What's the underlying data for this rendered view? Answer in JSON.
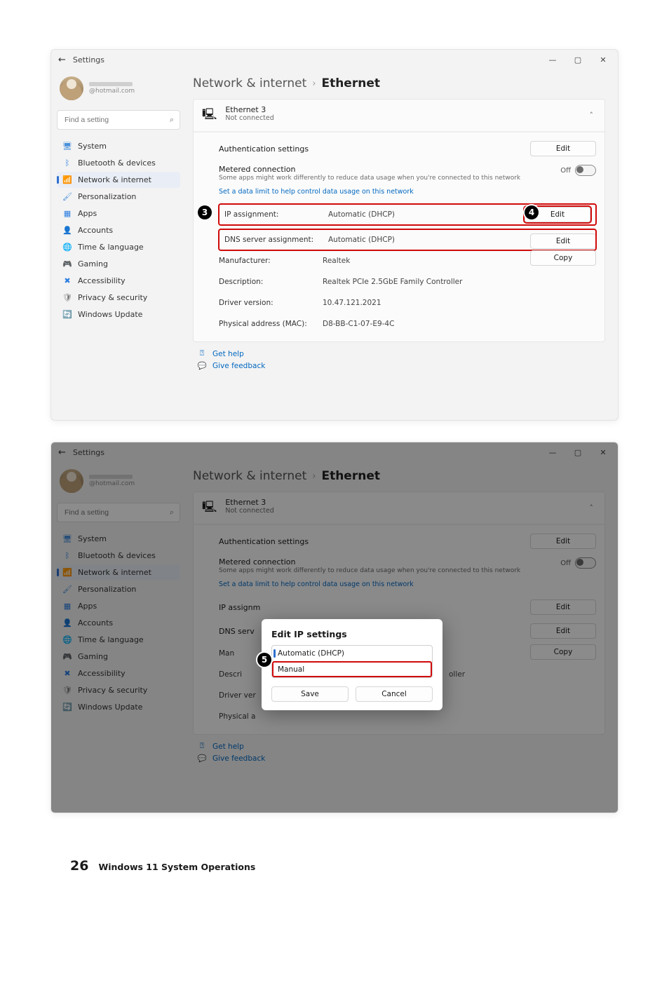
{
  "footer": {
    "page_number": "26",
    "book_title": "Windows 11 System Operations"
  },
  "window": {
    "app_title": "Settings",
    "account_email": "@hotmail.com",
    "search_placeholder": "Find a setting"
  },
  "sidebar_items": [
    {
      "icon": "🖥",
      "label": "System"
    },
    {
      "icon": "ᛒ",
      "label": "Bluetooth & devices"
    },
    {
      "icon": "📶",
      "label": "Network & internet"
    },
    {
      "icon": "🖌",
      "label": "Personalization"
    },
    {
      "icon": "▦",
      "label": "Apps"
    },
    {
      "icon": "👤",
      "label": "Accounts"
    },
    {
      "icon": "🌐",
      "label": "Time & language"
    },
    {
      "icon": "🎮",
      "label": "Gaming"
    },
    {
      "icon": "✖",
      "label": "Accessibility"
    },
    {
      "icon": "🛡",
      "label": "Privacy & security"
    },
    {
      "icon": "🔄",
      "label": "Windows Update"
    }
  ],
  "breadcrumb": {
    "a": "Network & internet",
    "b": "Ethernet"
  },
  "ethernet_header": {
    "name": "Ethernet 3",
    "status": "Not connected"
  },
  "rows": {
    "auth_label": "Authentication settings",
    "edit_btn": "Edit",
    "metered_label": "Metered connection",
    "metered_desc": "Some apps might work differently to reduce data usage when you're connected to this network",
    "metered_toggle": "Off",
    "data_limit_link": "Set a data limit to help control data usage on this network",
    "ip_label": "IP assignment:",
    "ip_value": "Automatic (DHCP)",
    "dns_label": "DNS server assignment:",
    "dns_value": "Automatic (DHCP)",
    "copy_btn": "Copy",
    "details": {
      "manufacturer_k": "Manufacturer:",
      "manufacturer_v": "Realtek",
      "description_k": "Description:",
      "description_v": "Realtek PCIe 2.5GbE Family Controller",
      "driver_k": "Driver version:",
      "driver_v": "10.47.121.2021",
      "mac_k": "Physical address (MAC):",
      "mac_v": "D8-BB-C1-07-E9-4C"
    }
  },
  "help": {
    "get_help": "Get help",
    "give_feedback": "Give feedback"
  },
  "badges": {
    "b3": "3",
    "b4": "4",
    "b5": "5"
  },
  "modal": {
    "title": "Edit IP settings",
    "opt_auto": "Automatic (DHCP)",
    "opt_manual": "Manual",
    "save": "Save",
    "cancel": "Cancel"
  },
  "second_bg_hint": "oller"
}
